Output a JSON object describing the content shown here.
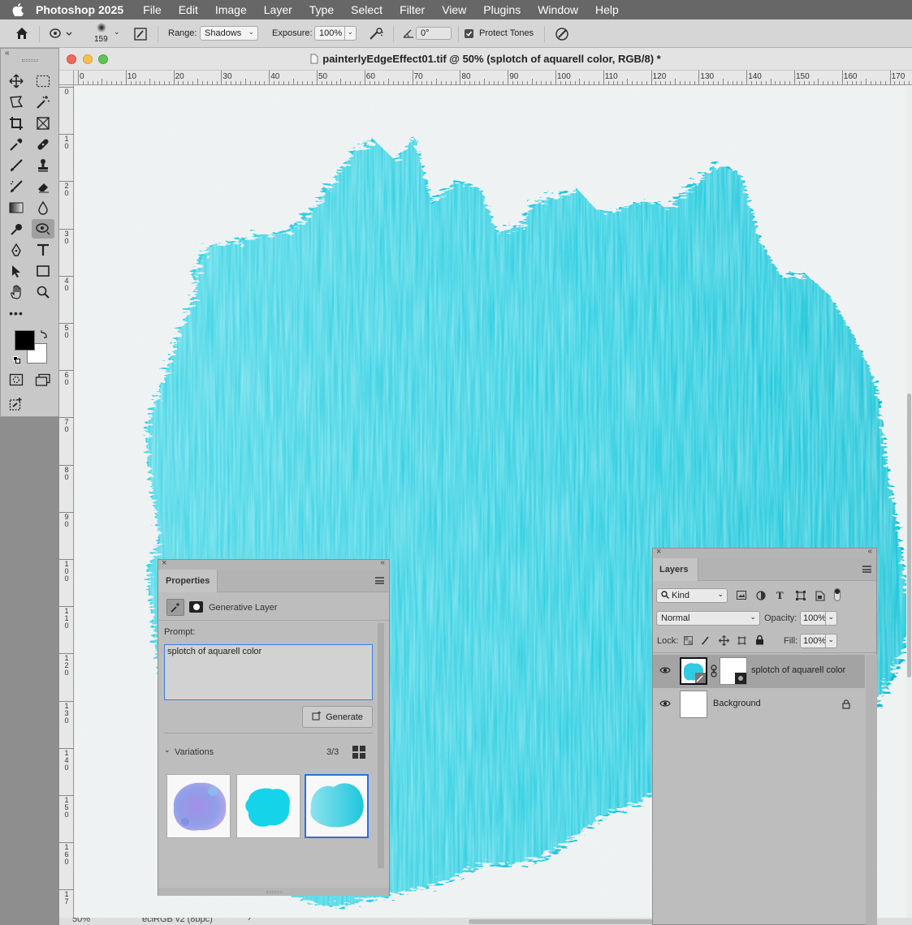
{
  "menubar": {
    "app_name": "Photoshop 2025",
    "items": [
      "File",
      "Edit",
      "Image",
      "Layer",
      "Type",
      "Select",
      "Filter",
      "View",
      "Plugins",
      "Window",
      "Help"
    ]
  },
  "options_bar": {
    "brush_size": "159",
    "range_label": "Range:",
    "range_value": "Shadows",
    "exposure_label": "Exposure:",
    "exposure_value": "100%",
    "angle_value": "0°",
    "protect_tones_label": "Protect Tones",
    "protect_tones_checked": true
  },
  "document": {
    "title": "painterlyEdgeEffect01.tif @ 50% (splotch of aquarell color, RGB/8) *",
    "ruler_h_ticks": [
      "0",
      "10",
      "20",
      "30",
      "40",
      "50",
      "60",
      "70",
      "80",
      "90",
      "100",
      "110",
      "120",
      "130",
      "140",
      "150",
      "160",
      "170"
    ],
    "ruler_v_ticks": [
      "0",
      "1 0",
      "2 0",
      "3 0",
      "4 0",
      "5 0",
      "6 0",
      "7 0",
      "8 0",
      "9 0",
      "1 0 0",
      "1 1 0",
      "1 2 0",
      "1 3 0",
      "1 4 0",
      "1 5 0",
      "1 6 0",
      "1 7"
    ],
    "zoom": "50%",
    "color_profile": "eciRGB v2 (8bpc)",
    "splash_color": "#1ccbe0"
  },
  "properties": {
    "tab_label": "Properties",
    "layer_type": "Generative Layer",
    "prompt_label": "Prompt:",
    "prompt_value": "splotch of aquarell color",
    "generate_label": "Generate",
    "variations_label": "Variations",
    "variations_count": "3/3",
    "selected_variation_index": 3
  },
  "layers": {
    "tab_label": "Layers",
    "filter_kind": "Kind",
    "blend_mode": "Normal",
    "opacity_label": "Opacity:",
    "opacity_value": "100%",
    "lock_label": "Lock:",
    "fill_label": "Fill:",
    "fill_value": "100%",
    "items": [
      {
        "name": "splotch of aquarell color",
        "selected": true
      },
      {
        "name": "Background",
        "selected": false,
        "locked": true
      }
    ]
  },
  "colors": {
    "foreground": "#000000",
    "background": "#ffffff",
    "selection_accent": "#2f6fe0"
  }
}
